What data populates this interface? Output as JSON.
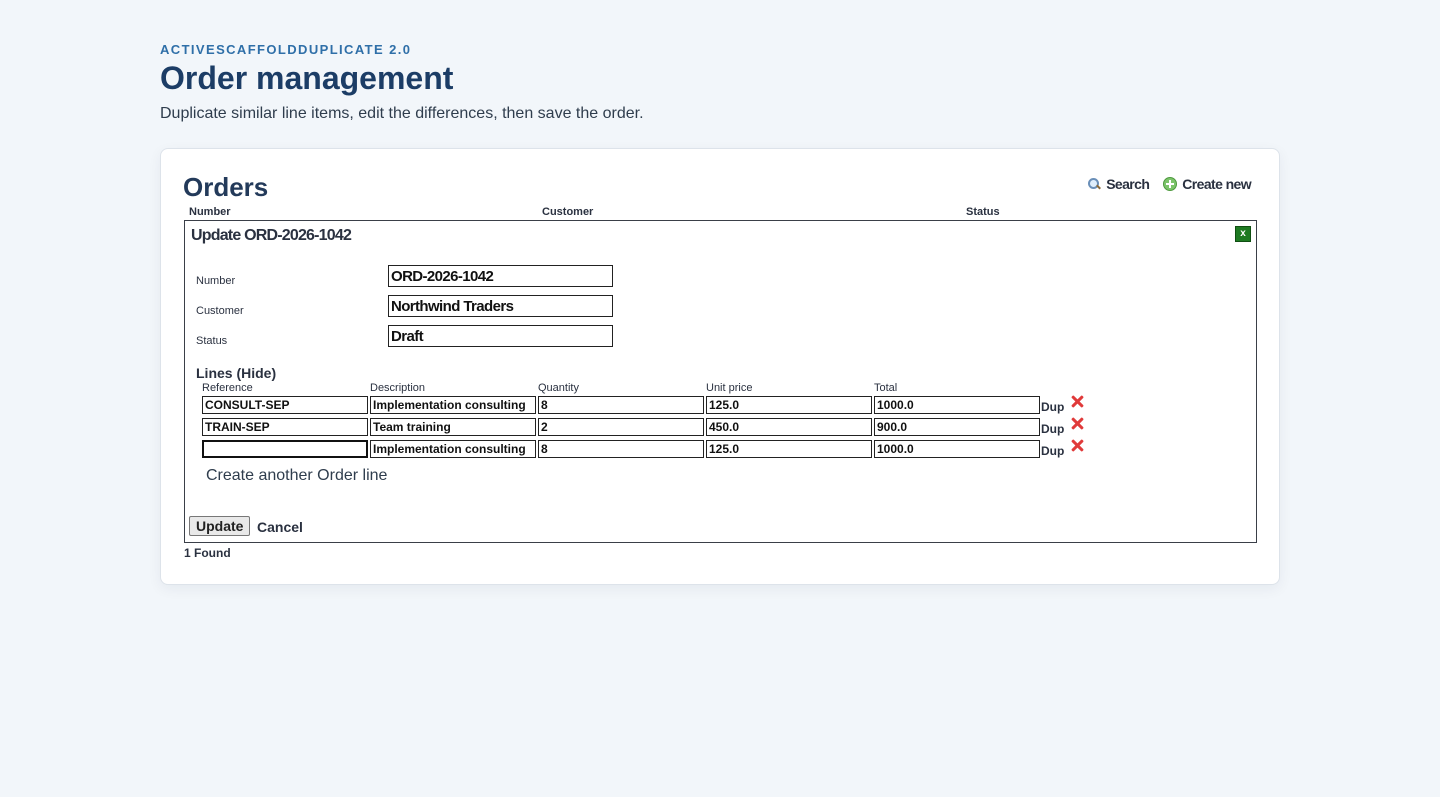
{
  "header": {
    "eyebrow": "ACTIVESCAFFOLDDUPLICATE 2.0",
    "title": "Order management",
    "subtitle": "Duplicate similar line items, edit the differences, then save the order."
  },
  "orders": {
    "title": "Orders",
    "actions": {
      "search": "Search",
      "create": "Create new"
    },
    "columns": [
      "Number",
      "Customer",
      "Status"
    ],
    "found": "1 Found"
  },
  "update_form": {
    "title": "Update ORD-2026-1042",
    "close_label": "x",
    "fields": {
      "number": {
        "label": "Number",
        "value": "ORD-2026-1042"
      },
      "customer": {
        "label": "Customer",
        "value": "Northwind Traders"
      },
      "status": {
        "label": "Status",
        "value": "Draft"
      }
    },
    "lines": {
      "heading": "Lines",
      "toggle": "(Hide)",
      "columns": [
        "Reference",
        "Description",
        "Quantity",
        "Unit price",
        "Total"
      ],
      "rows": [
        {
          "reference": "CONSULT-SEP",
          "description": "Implementation consulting",
          "quantity": "8",
          "unit_price": "125.0",
          "total": "1000.0"
        },
        {
          "reference": "TRAIN-SEP",
          "description": "Team training",
          "quantity": "2",
          "unit_price": "450.0",
          "total": "900.0"
        },
        {
          "reference": "",
          "description": "Implementation consulting",
          "quantity": "8",
          "unit_price": "125.0",
          "total": "1000.0"
        }
      ],
      "dup_label": "Dup",
      "create_another": "Create another Order line"
    },
    "submit_label": "Update",
    "cancel_label": "Cancel"
  }
}
